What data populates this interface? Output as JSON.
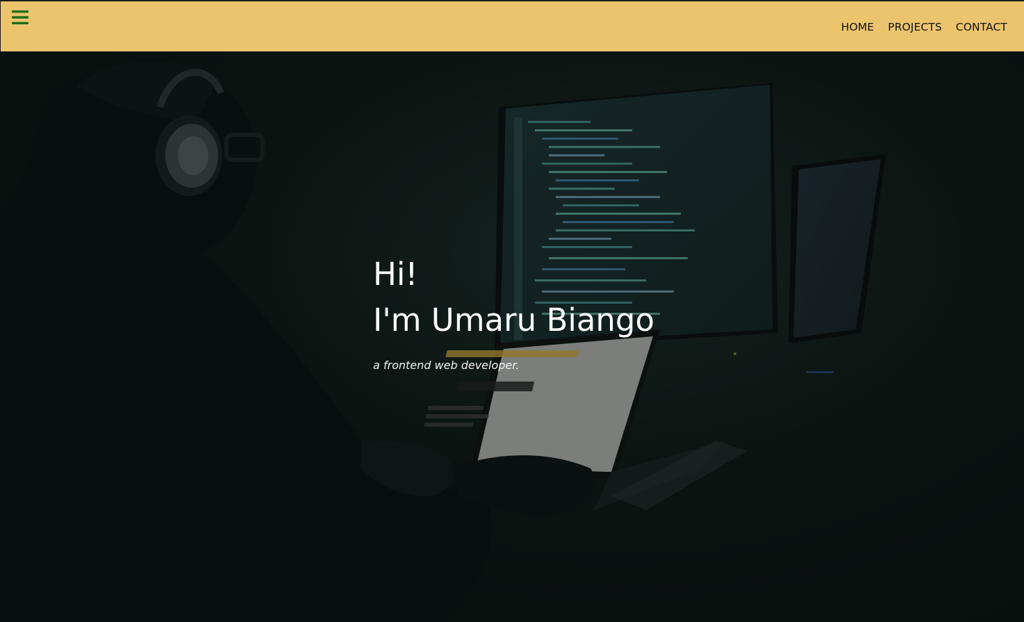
{
  "nav": {
    "menu_icon": "hamburger-menu-icon",
    "links": [
      {
        "label": "HOME"
      },
      {
        "label": "PROJECTS"
      },
      {
        "label": "CONTACT"
      }
    ]
  },
  "hero": {
    "greeting_line1": "Hi!",
    "greeting_line2": "I'm Umaru Biango",
    "subtitle": "a frontend web developer.",
    "background_image": "developer-at-desk-with-monitors-photo"
  },
  "colors": {
    "header_bg": "#ebc46d",
    "menu_icon": "#1d6b17",
    "hero_text": "#ffffff",
    "hero_bg": "#0c1210"
  }
}
